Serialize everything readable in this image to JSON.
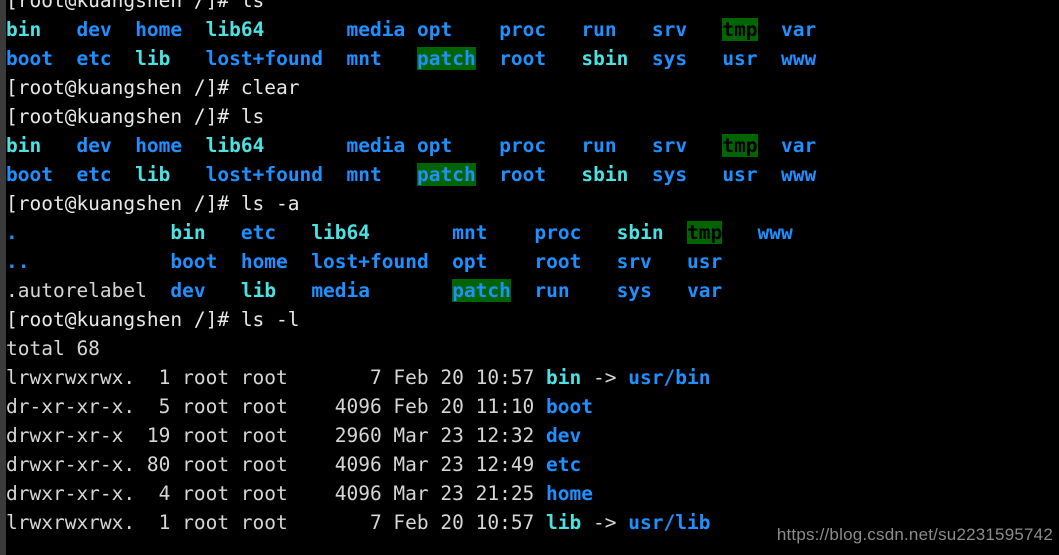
{
  "terminal": {
    "hostname": "kuangshen",
    "user": "root",
    "cwd": "/",
    "prompt": "[root@kuangshen /]# ",
    "background_color": "#000000",
    "default_fg_color": "#d6d6d6",
    "dir_color": "#1e90ff",
    "link_color": "#4ae3e3",
    "sticky_bg_color": "#006400",
    "scrollbar_color": "#3b3b3b"
  },
  "watermark": {
    "text": "https://blog.csdn.net/su2231595742",
    "color": "#8c8c8c"
  },
  "lines": [
    {
      "type": "command",
      "prompt": "[root@kuangshen /]# ",
      "command": "ls"
    },
    {
      "type": "ls-columns",
      "rows": [
        [
          {
            "text": "bin",
            "style": "link"
          },
          {
            "text": "dev",
            "style": "dir"
          },
          {
            "text": "home",
            "style": "dir"
          },
          {
            "text": "lib64",
            "style": "link"
          },
          {
            "text": "media",
            "style": "dir"
          },
          {
            "text": "opt",
            "style": "dir"
          },
          {
            "text": "proc",
            "style": "dir"
          },
          {
            "text": "run",
            "style": "dir"
          },
          {
            "text": "srv",
            "style": "dir"
          },
          {
            "text": "tmp",
            "style": "sticky"
          },
          {
            "text": "var",
            "style": "dir"
          }
        ],
        [
          {
            "text": "boot",
            "style": "dir"
          },
          {
            "text": "etc",
            "style": "dir"
          },
          {
            "text": "lib",
            "style": "link"
          },
          {
            "text": "lost+found",
            "style": "dir"
          },
          {
            "text": "mnt",
            "style": "dir"
          },
          {
            "text": "patch",
            "style": "otherwritable"
          },
          {
            "text": "root",
            "style": "dir"
          },
          {
            "text": "sbin",
            "style": "link"
          },
          {
            "text": "sys",
            "style": "dir"
          },
          {
            "text": "usr",
            "style": "dir"
          },
          {
            "text": "www",
            "style": "dir"
          }
        ]
      ],
      "col_starts": [
        0,
        6,
        11,
        17,
        29,
        35,
        42,
        49,
        55,
        61,
        66
      ]
    },
    {
      "type": "command",
      "prompt": "[root@kuangshen /]# ",
      "command": "clear"
    },
    {
      "type": "command",
      "prompt": "[root@kuangshen /]# ",
      "command": "ls"
    },
    {
      "type": "ls-columns",
      "rows": [
        [
          {
            "text": "bin",
            "style": "link"
          },
          {
            "text": "dev",
            "style": "dir"
          },
          {
            "text": "home",
            "style": "dir"
          },
          {
            "text": "lib64",
            "style": "link"
          },
          {
            "text": "media",
            "style": "dir"
          },
          {
            "text": "opt",
            "style": "dir"
          },
          {
            "text": "proc",
            "style": "dir"
          },
          {
            "text": "run",
            "style": "dir"
          },
          {
            "text": "srv",
            "style": "dir"
          },
          {
            "text": "tmp",
            "style": "sticky"
          },
          {
            "text": "var",
            "style": "dir"
          }
        ],
        [
          {
            "text": "boot",
            "style": "dir"
          },
          {
            "text": "etc",
            "style": "dir"
          },
          {
            "text": "lib",
            "style": "link"
          },
          {
            "text": "lost+found",
            "style": "dir"
          },
          {
            "text": "mnt",
            "style": "dir"
          },
          {
            "text": "patch",
            "style": "otherwritable"
          },
          {
            "text": "root",
            "style": "dir"
          },
          {
            "text": "sbin",
            "style": "link"
          },
          {
            "text": "sys",
            "style": "dir"
          },
          {
            "text": "usr",
            "style": "dir"
          },
          {
            "text": "www",
            "style": "dir"
          }
        ]
      ],
      "col_starts": [
        0,
        6,
        11,
        17,
        29,
        35,
        42,
        49,
        55,
        61,
        66
      ]
    },
    {
      "type": "command",
      "prompt": "[root@kuangshen /]# ",
      "command": "ls -a"
    },
    {
      "type": "ls-columns",
      "rows": [
        [
          {
            "text": ".",
            "style": "dir"
          },
          {
            "text": "bin",
            "style": "link"
          },
          {
            "text": "etc",
            "style": "dir"
          },
          {
            "text": "lib64",
            "style": "link"
          },
          {
            "text": "mnt",
            "style": "dir"
          },
          {
            "text": "proc",
            "style": "dir"
          },
          {
            "text": "sbin",
            "style": "link"
          },
          {
            "text": "tmp",
            "style": "sticky"
          },
          {
            "text": "www",
            "style": "dir"
          }
        ],
        [
          {
            "text": "..",
            "style": "dir"
          },
          {
            "text": "boot",
            "style": "dir"
          },
          {
            "text": "home",
            "style": "dir"
          },
          {
            "text": "lost+found",
            "style": "dir"
          },
          {
            "text": "opt",
            "style": "dir"
          },
          {
            "text": "root",
            "style": "dir"
          },
          {
            "text": "srv",
            "style": "dir"
          },
          {
            "text": "usr",
            "style": "dir"
          }
        ],
        [
          {
            "text": ".autorelabel",
            "style": "default"
          },
          {
            "text": "dev",
            "style": "dir"
          },
          {
            "text": "lib",
            "style": "link"
          },
          {
            "text": "media",
            "style": "dir"
          },
          {
            "text": "patch",
            "style": "otherwritable"
          },
          {
            "text": "run",
            "style": "dir"
          },
          {
            "text": "sys",
            "style": "dir"
          },
          {
            "text": "var",
            "style": "dir"
          }
        ]
      ],
      "col_starts": [
        0,
        14,
        20,
        26,
        38,
        45,
        52,
        58,
        64
      ]
    },
    {
      "type": "command",
      "prompt": "[root@kuangshen /]# ",
      "command": "ls -l"
    },
    {
      "type": "text",
      "text": "total 68",
      "style": "default"
    },
    {
      "type": "ls-long",
      "perms": "lrwxrwxrwx.",
      "links": "1",
      "owner": "root",
      "group": "root",
      "size": "7",
      "month": "Feb",
      "day": "20",
      "time": "10:57",
      "name": "bin",
      "name_style": "link",
      "arrow": "->",
      "target": "usr/bin",
      "target_style": "dir"
    },
    {
      "type": "ls-long",
      "perms": "dr-xr-xr-x.",
      "links": "5",
      "owner": "root",
      "group": "root",
      "size": "4096",
      "month": "Feb",
      "day": "20",
      "time": "11:10",
      "name": "boot",
      "name_style": "dir",
      "arrow": "",
      "target": "",
      "target_style": ""
    },
    {
      "type": "ls-long",
      "perms": "drwxr-xr-x",
      "links": "19",
      "owner": "root",
      "group": "root",
      "size": "2960",
      "month": "Mar",
      "day": "23",
      "time": "12:32",
      "name": "dev",
      "name_style": "dir",
      "arrow": "",
      "target": "",
      "target_style": ""
    },
    {
      "type": "ls-long",
      "perms": "drwxr-xr-x.",
      "links": "80",
      "owner": "root",
      "group": "root",
      "size": "4096",
      "month": "Mar",
      "day": "23",
      "time": "12:49",
      "name": "etc",
      "name_style": "dir",
      "arrow": "",
      "target": "",
      "target_style": ""
    },
    {
      "type": "ls-long",
      "perms": "drwxr-xr-x.",
      "links": "4",
      "owner": "root",
      "group": "root",
      "size": "4096",
      "month": "Mar",
      "day": "23",
      "time": "21:25",
      "name": "home",
      "name_style": "dir",
      "arrow": "",
      "target": "",
      "target_style": ""
    },
    {
      "type": "ls-long",
      "perms": "lrwxrwxrwx.",
      "links": "1",
      "owner": "root",
      "group": "root",
      "size": "7",
      "month": "Feb",
      "day": "20",
      "time": "10:57",
      "name": "lib",
      "name_style": "link",
      "arrow": "->",
      "target": "usr/lib",
      "target_style": "dir"
    }
  ]
}
